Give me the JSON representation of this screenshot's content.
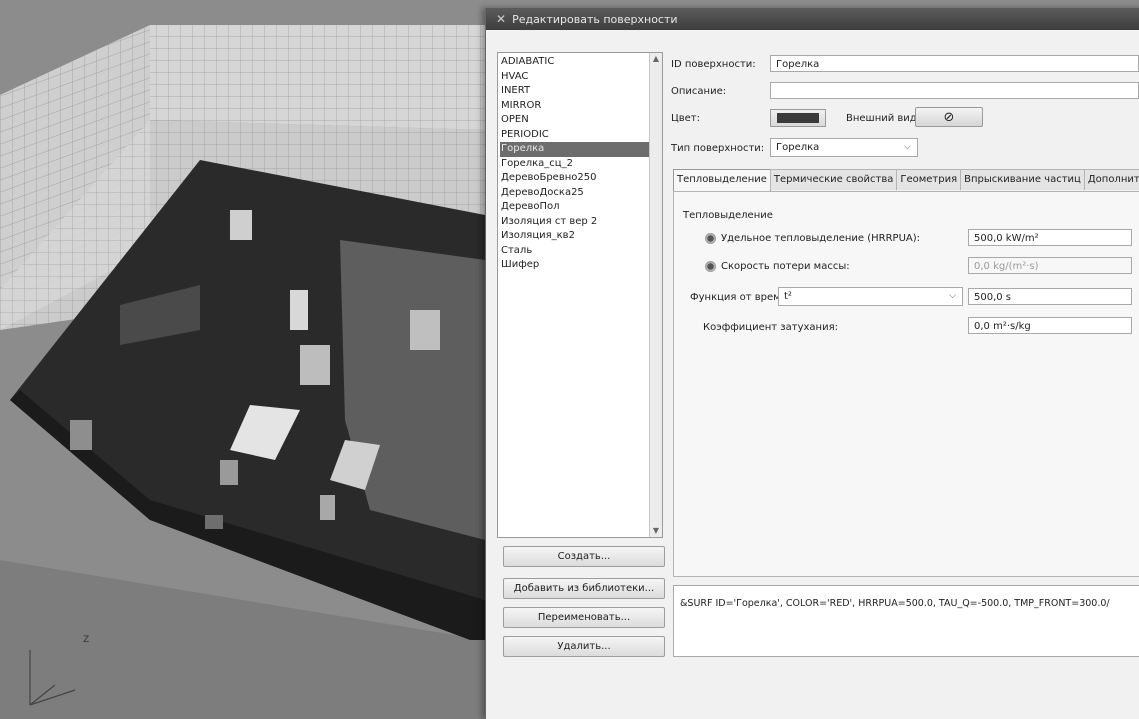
{
  "dialog": {
    "title": "Редактировать поверхности",
    "icon": "app-icon"
  },
  "surface_list": {
    "items": [
      "ADIABATIC",
      "HVAC",
      "INERT",
      "MIRROR",
      "OPEN",
      "PERIODIC",
      "Горелка",
      "Горелка_сц_2",
      "ДеревоБревно250",
      "ДеревоДоска25",
      "ДеревоПол",
      "Изоляция ст вер 2",
      "Изоляция_кв2",
      "Сталь",
      "Шифер"
    ],
    "selected": "Горелка"
  },
  "buttons": {
    "create": "Создать...",
    "add_from_library": "Добавить из библиотеки...",
    "rename": "Переименовать...",
    "delete": "Удалить..."
  },
  "form": {
    "id_label": "ID поверхности:",
    "id_value": "Горелка",
    "description_label": "Описание:",
    "description_value": "",
    "color_label": "Цвет:",
    "color_value": "#3a3a3a",
    "appearance_label": "Внешний вид:",
    "appearance_icon": "no-texture-icon",
    "type_label": "Тип поверхности:",
    "type_value": "Горелка"
  },
  "tabs": [
    "Тепловыделение",
    "Термические свойства",
    "Геометрия",
    "Впрыскивание частиц",
    "Дополнительно"
  ],
  "active_tab": "Тепловыделение",
  "heat_release": {
    "section_title": "Тепловыделение",
    "hrrpua_label": "Удельное тепловыделение (HRRPUA):",
    "hrrpua_value": "500,0 kW/m²",
    "mass_loss_label": "Скорость потери массы:",
    "mass_loss_value": "0,0 kg/(m²·s)",
    "time_function_label": "Функция от времени:",
    "time_function_value": "t²",
    "time_value": "500,0 s",
    "damping_label": "Коэффициент затухания:",
    "damping_value": "0,0 m²·s/kg"
  },
  "code_preview": "&SURF ID='Горелка', COLOR='RED', HRRPUA=500.0, TAU_Q=-500.0, TMP_FRONT=300.0/"
}
